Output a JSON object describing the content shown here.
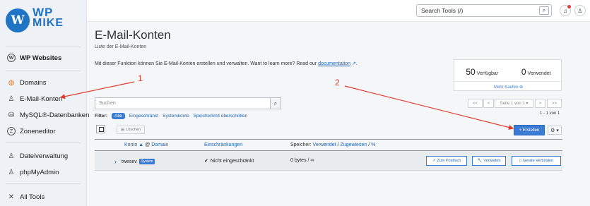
{
  "logo": {
    "line1": "WP",
    "line2": "MIKE"
  },
  "sidebar": {
    "items": [
      {
        "label": "WP Websites",
        "icon": "wordpress-icon"
      },
      {
        "label": "Domains",
        "icon": "globe-icon"
      },
      {
        "label": "E-Mail-Konten",
        "icon": "user-mail-icon"
      },
      {
        "label": "MySQL®-Datenbanken",
        "icon": "database-icon"
      },
      {
        "label": "Zoneneditor",
        "icon": "zone-icon"
      },
      {
        "label": "Dateiverwaltung",
        "icon": "user-files-icon"
      },
      {
        "label": "phpMyAdmin",
        "icon": "user-admin-icon"
      },
      {
        "label": "All Tools",
        "icon": "tools-icon"
      }
    ]
  },
  "topbar": {
    "search_placeholder": "Search Tools (/)"
  },
  "page": {
    "title": "E-Mail-Konten",
    "subtitle": "Liste der E-Mail-Konten",
    "intro": "Mit dieser Funktion können Sie E-Mail-Konten erstellen und verwalten. Want to learn more? Read our",
    "intro_link": "documentation",
    "intro_end": "."
  },
  "stats": {
    "available_count": "50",
    "available_label": "Verfügbar",
    "used_count": "0",
    "used_label": "Verwendet",
    "buy_more": "Mehr Kaufen ⊕"
  },
  "search": {
    "placeholder": "Suchen"
  },
  "pager": {
    "first": "<<",
    "prev": "<",
    "page": "Seite 1 von 1 ▾",
    "next": ">",
    "last": ">>",
    "count": "1 - 1 von 1"
  },
  "filter": {
    "label": "Filter:",
    "options": [
      "Alle",
      "Eingeschränkt",
      "Systemkonto",
      "Speicherlimit überschritten"
    ]
  },
  "toolbar": {
    "delete_label": "Löschen",
    "create_label": "+ Erstellen",
    "gear_label": "⚙ ▾"
  },
  "table": {
    "headers": {
      "account": "Konto",
      "account_sort": "▲",
      "at": "@",
      "domain": "Domain",
      "restrictions": "Einschränkungen",
      "storage_label": "Speicher:",
      "storage_used": "Verwendet",
      "slash1": "/",
      "storage_assigned": "Zugewiesen",
      "slash2": "/",
      "storage_pct": "%"
    },
    "rows": [
      {
        "account": "twesev",
        "badge": "System",
        "restriction": "Nicht eingeschränkt",
        "storage": "0 bytes / ∞",
        "btn_mailbox": "Zum Postfach",
        "btn_manage": "Verwalten",
        "btn_devices": "Geräte Verbinden"
      }
    ]
  },
  "annotations": {
    "label1": "1",
    "label2": "2",
    "color": "#e53b2f"
  },
  "colors": {
    "accent": "#3a7bd5",
    "brand": "#1f74c6",
    "annotation": "#e53b2f"
  }
}
